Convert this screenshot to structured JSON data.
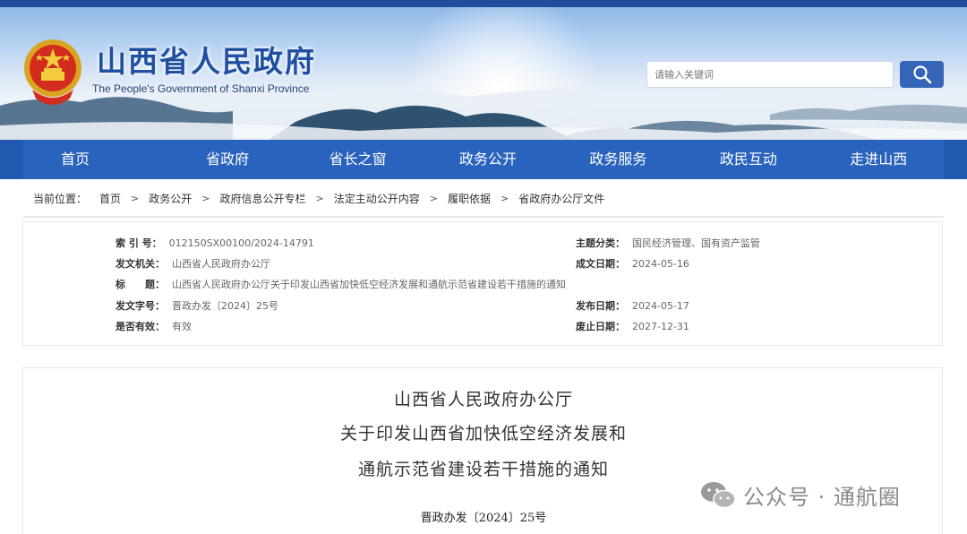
{
  "header": {
    "site_title": "山西省人民政府",
    "site_subtitle": "The People's Government of Shanxi Province",
    "search_placeholder": "请输入关键词"
  },
  "nav": {
    "items": [
      "首页",
      "省政府",
      "省长之窗",
      "政务公开",
      "政务服务",
      "政民互动",
      "走进山西"
    ]
  },
  "breadcrumb": {
    "prefix": "当前位置：",
    "items": [
      "首页",
      "政务公开",
      "政府信息公开专栏",
      "法定主动公开内容",
      "履职依据",
      "省政府办公厅文件"
    ],
    "separator": ">"
  },
  "info": {
    "index_label": "索 引 号：",
    "index_value": "012150SX00100/2024-14791",
    "topic_label": "主题分类：",
    "topic_value": "国民经济管理、国有资产监管",
    "issuer_label": "发文机关：",
    "issuer_value": "山西省人民政府办公厅",
    "written_label": "成文日期：",
    "written_value": "2024-05-16",
    "title_label": "标　　题：",
    "title_value": "山西省人民政府办公厅关于印发山西省加快低空经济发展和通航示范省建设若干措施的通知",
    "docno_label": "发文字号：",
    "docno_value": "晋政办发〔2024〕25号",
    "published_label": "发布日期：",
    "published_value": "2024-05-17",
    "valid_label": "是否有效：",
    "valid_value": "有效",
    "expiry_label": "废止日期：",
    "expiry_value": "2027-12-31"
  },
  "document": {
    "line1": "山西省人民政府办公厅",
    "line2": "关于印发山西省加快低空经济发展和",
    "line3": "通航示范省建设若干措施的通知",
    "number": "晋政办发〔2024〕25号"
  },
  "watermark": {
    "text": "公众号 · 通航圈",
    "icon": "wechat-icon"
  },
  "colors": {
    "nav_bg": "#2a63bd",
    "title_blue": "#1e4fa0",
    "search_btn": "#3565b7"
  }
}
